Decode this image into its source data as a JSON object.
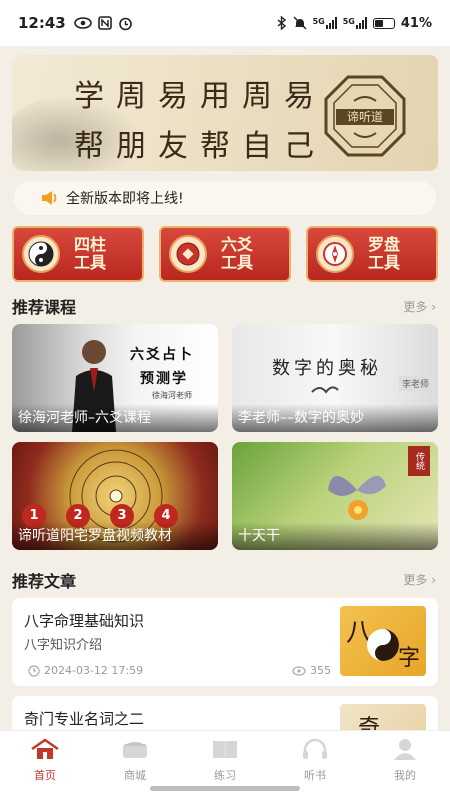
{
  "status": {
    "time": "12:43",
    "battery": "41%",
    "network": "5G"
  },
  "banner": {
    "line1": "学周易用周易",
    "line2": "帮朋友帮自己",
    "logo_text": "谛听道"
  },
  "notice": {
    "text": "全新版本即将上线!"
  },
  "tools": [
    {
      "label": "四柱\n工具",
      "icon": "yin-yang-icon"
    },
    {
      "label": "六爻\n工具",
      "icon": "coin-icon"
    },
    {
      "label": "罗盘\n工具",
      "icon": "compass-icon"
    }
  ],
  "courses": {
    "title": "推荐课程",
    "more": "更多 ›",
    "items": [
      {
        "caption": "徐海河老师–六爻课程",
        "overlay_title": "六爻占卜",
        "overlay_sub": "预测学",
        "overlay_small": "徐海河老师"
      },
      {
        "caption": "李老师––数字的奥妙",
        "overlay_title": "数字的奥秘",
        "overlay_small": "李老师"
      },
      {
        "caption": "谛听道阳宅罗盘视频教材",
        "overlay_numbers": [
          "1",
          "2",
          "3",
          "4"
        ]
      },
      {
        "caption": "十天干",
        "overlay_small": "传统"
      }
    ]
  },
  "articles": {
    "title": "推荐文章",
    "more": "更多 ›",
    "items": [
      {
        "title": "八字命理基础知识",
        "subtitle": "八字知识介绍",
        "date": "2024-03-12 17:59",
        "views": "355",
        "thumb_text": [
          "八",
          "字"
        ]
      },
      {
        "title": "奇门专业名词之二",
        "thumb_text": [
          "奇"
        ]
      }
    ]
  },
  "tabbar": {
    "items": [
      {
        "label": "首页",
        "icon": "home-icon",
        "active": true
      },
      {
        "label": "商城",
        "icon": "shop-icon",
        "active": false
      },
      {
        "label": "练习",
        "icon": "book-icon",
        "active": false
      },
      {
        "label": "听书",
        "icon": "headphones-icon",
        "active": false
      },
      {
        "label": "我的",
        "icon": "profile-icon",
        "active": false
      }
    ]
  },
  "colors": {
    "accent": "#c0392b",
    "tool_red": "#c8342a",
    "tool_gold": "#e9b26d",
    "background": "#f4efe6"
  }
}
